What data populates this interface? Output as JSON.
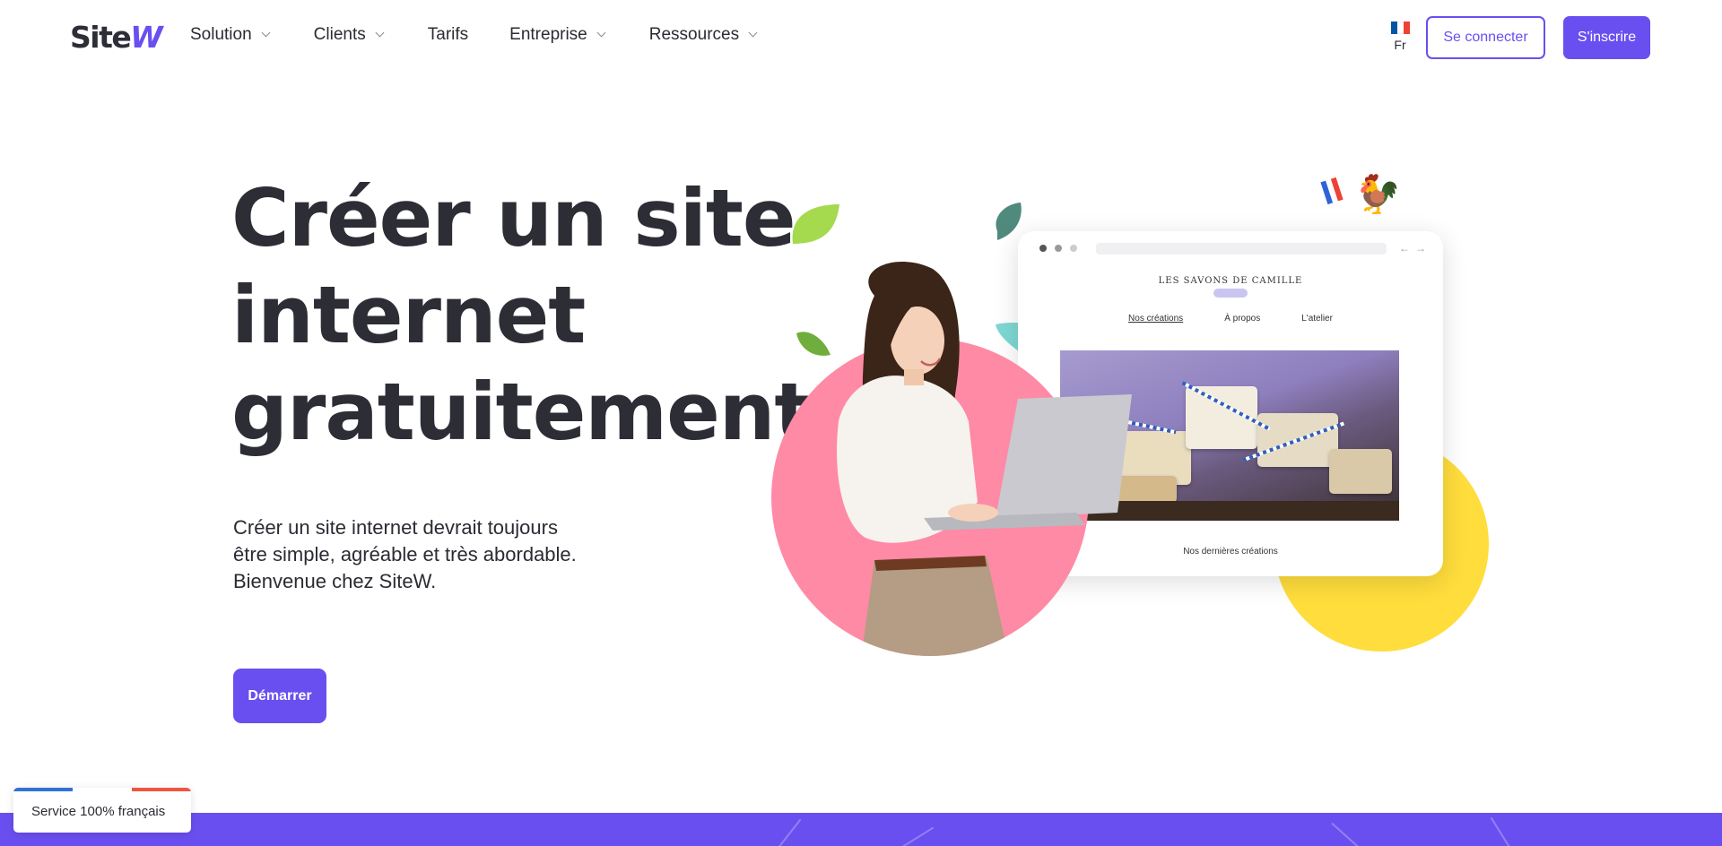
{
  "header": {
    "logo": {
      "text_main": "Site",
      "text_accent": "W"
    },
    "nav": [
      {
        "label": "Solution",
        "has_dropdown": true
      },
      {
        "label": "Clients",
        "has_dropdown": true
      },
      {
        "label": "Tarifs",
        "has_dropdown": false
      },
      {
        "label": "Entreprise",
        "has_dropdown": true
      },
      {
        "label": "Ressources",
        "has_dropdown": true
      }
    ],
    "language": {
      "label": "Fr",
      "flag_colors": [
        "#0055a4",
        "#ffffff",
        "#ef4135"
      ]
    },
    "login_label": "Se connecter",
    "signup_label": "S'inscrire"
  },
  "hero": {
    "title_lines": [
      "Créer un site",
      "internet",
      "gratuitement"
    ],
    "subtitle_lines": [
      "Créer un site internet devrait toujours",
      "être simple, agréable et très abordable.",
      "Bienvenue chez SiteW."
    ],
    "cta_label": "Démarrer"
  },
  "mockup": {
    "brand": "LES SAVONS DE CAMILLE",
    "nav": [
      "Nos créations",
      "À propos",
      "L'atelier"
    ],
    "caption": "Nos dernières créations"
  },
  "badge": {
    "text": "Service 100% français"
  },
  "colors": {
    "brand": "#6a4ff0",
    "text": "#2d2d35",
    "pink_circle": "#ff8aa5",
    "yellow_circle": "#ffdd3c"
  },
  "icons": [
    "chevron-down-icon",
    "france-flag-icon",
    "rooster-icon",
    "leaf-icon"
  ]
}
